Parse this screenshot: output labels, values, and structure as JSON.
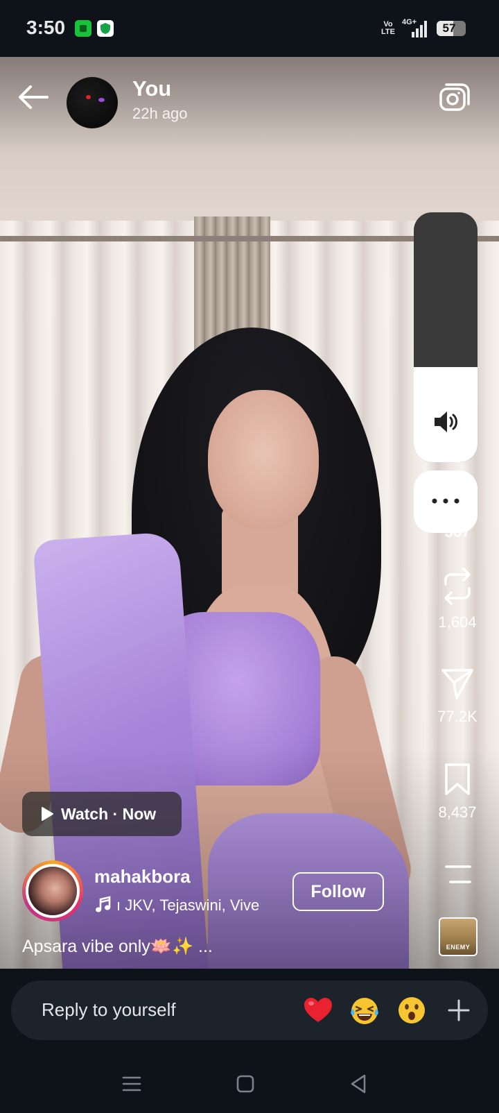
{
  "status_bar": {
    "time": "3:50",
    "network": "4G+",
    "volte_line1": "Vo",
    "volte_line2": "LTE",
    "battery": "57",
    "battery_level": 0.57
  },
  "story": {
    "user": "You",
    "time_ago": "22h ago"
  },
  "volume": {
    "level": 0.38
  },
  "actions": {
    "likes_partial": "367",
    "reposts": "1,604",
    "shares": "77.2K",
    "saves": "8,437"
  },
  "watch": {
    "label": "Watch · Now"
  },
  "creator": {
    "name": "mahakbora",
    "music": "ı JKV, Tejaswini, Vive",
    "follow": "Follow",
    "caption": "Apsara vibe only🪷✨ ...",
    "music_thumb_text": "ENEMY"
  },
  "reply": {
    "placeholder": "Reply to yourself",
    "reactions": [
      "heart-emoji",
      "laughing-emoji",
      "surprised-emoji"
    ]
  },
  "colors": {
    "background": "#0e131a",
    "reply_bar": "#1d232b",
    "accent_purple": "#a47fd6"
  }
}
